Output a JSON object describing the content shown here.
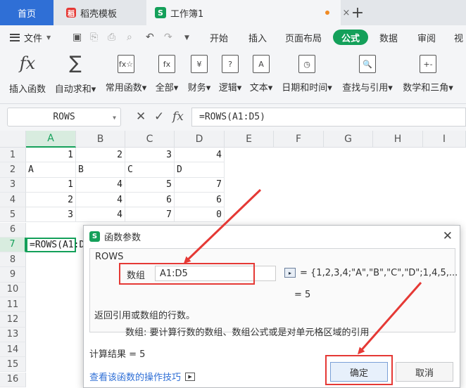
{
  "tabs": {
    "home": "首页",
    "doc": {
      "icon": "稻",
      "label": "稻壳模板"
    },
    "book": {
      "icon": "S",
      "label": "工作簿1"
    },
    "close": "×",
    "add": "+"
  },
  "menu": {
    "file": "文件",
    "items": [
      "开始",
      "插入",
      "页面布局",
      "公式",
      "数据",
      "审阅",
      "视"
    ],
    "active": "公式"
  },
  "ribbon": [
    {
      "icon": "fx",
      "label": "插入函数"
    },
    {
      "icon": "∑",
      "label": "自动求和▾"
    },
    {
      "icon": "fx☆",
      "label": "常用函数▾"
    },
    {
      "icon": "fx",
      "label": "全部▾"
    },
    {
      "icon": "¥",
      "label": "财务▾"
    },
    {
      "icon": "?",
      "label": "逻辑▾"
    },
    {
      "icon": "A",
      "label": "文本▾"
    },
    {
      "icon": "◷",
      "label": "日期和时间▾"
    },
    {
      "icon": "🔍",
      "label": "查找与引用▾"
    },
    {
      "icon": "+-",
      "label": "数学和三角▾"
    }
  ],
  "formula_bar": {
    "name_box": "ROWS",
    "cancel": "✕",
    "confirm": "✓",
    "fx": "fx",
    "content": "=ROWS(A1:D5)"
  },
  "columns": [
    "A",
    "B",
    "C",
    "D",
    "E",
    "F",
    "G",
    "H",
    "I"
  ],
  "rows": [
    "1",
    "2",
    "3",
    "4",
    "5",
    "6",
    "7",
    "8",
    "9",
    "10",
    "11",
    "12",
    "13",
    "14",
    "15",
    "16"
  ],
  "cells": {
    "r1": [
      "1",
      "2",
      "3",
      "4"
    ],
    "r2": [
      "A",
      "B",
      "C",
      "D"
    ],
    "r3": [
      "1",
      "4",
      "5",
      "7"
    ],
    "r4": [
      "2",
      "4",
      "6",
      "6"
    ],
    "r5": [
      "3",
      "4",
      "7",
      "0"
    ],
    "a7": "=ROWS(A1:D"
  },
  "dialog": {
    "title_icon": "S",
    "title": "函数参数",
    "close": "✕",
    "group_label": "ROWS",
    "arg_label": "数组",
    "arg_value": "A1:D5",
    "arg_eval": "= {1,2,3,4;\"A\",\"B\",\"C\",\"D\";1,4,5,...",
    "result_eq": "= 5",
    "description": "返回引用或数组的行数。",
    "arg_description": "数组:  要计算行数的数组、数组公式或是对单元格区域的引用",
    "calc_result": "计算结果 = 5",
    "help_link": "查看该函数的操作技巧",
    "ok": "确定",
    "cancel": "取消"
  },
  "colors": {
    "accent": "#14a05a",
    "tab_home": "#2f6fd6",
    "annotation": "#e53935"
  }
}
